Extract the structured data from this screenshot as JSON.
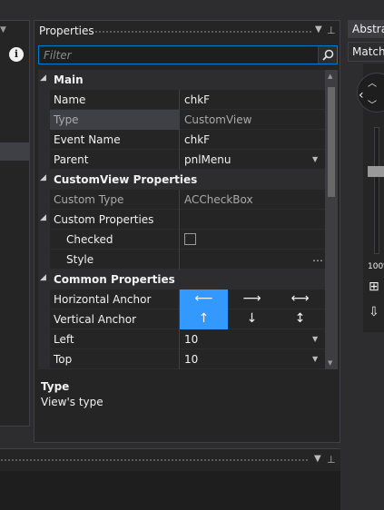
{
  "properties_window": {
    "title": "Properties",
    "filter_placeholder": "Filter",
    "rows": {
      "main": {
        "label": "Main"
      },
      "name": {
        "label": "Name",
        "value": "chkF"
      },
      "type": {
        "label": "Type",
        "value": "CustomView"
      },
      "event_name": {
        "label": "Event Name",
        "value": "chkF"
      },
      "parent": {
        "label": "Parent",
        "value": "pnlMenu"
      },
      "customview_props": {
        "label": "CustomView Properties"
      },
      "custom_type": {
        "label": "Custom Type",
        "value": "ACCheckBox"
      },
      "custom_props": {
        "label": "Custom Properties"
      },
      "checked": {
        "label": "Checked",
        "value": false
      },
      "style": {
        "label": "Style",
        "value": ""
      },
      "common_props": {
        "label": "Common Properties"
      },
      "h_anchor": {
        "label": "Horizontal Anchor",
        "selected": "left"
      },
      "v_anchor": {
        "label": "Vertical Anchor",
        "selected": "top"
      },
      "left": {
        "label": "Left",
        "value": "10"
      },
      "top": {
        "label": "Top",
        "value": "10"
      }
    },
    "description": {
      "title": "Type",
      "text": "View's type"
    }
  },
  "right_pane": {
    "tab_label": "Abstra",
    "match_label": "Match",
    "zoom": "100%"
  },
  "icons": {
    "filter_search": "search-icon",
    "info": "info-icon",
    "pin": "pin-icon",
    "dropdown": "dropdown-icon"
  },
  "colors": {
    "accent": "#007acc",
    "anchor_selected": "#3399ff",
    "background": "#2d2d30"
  }
}
